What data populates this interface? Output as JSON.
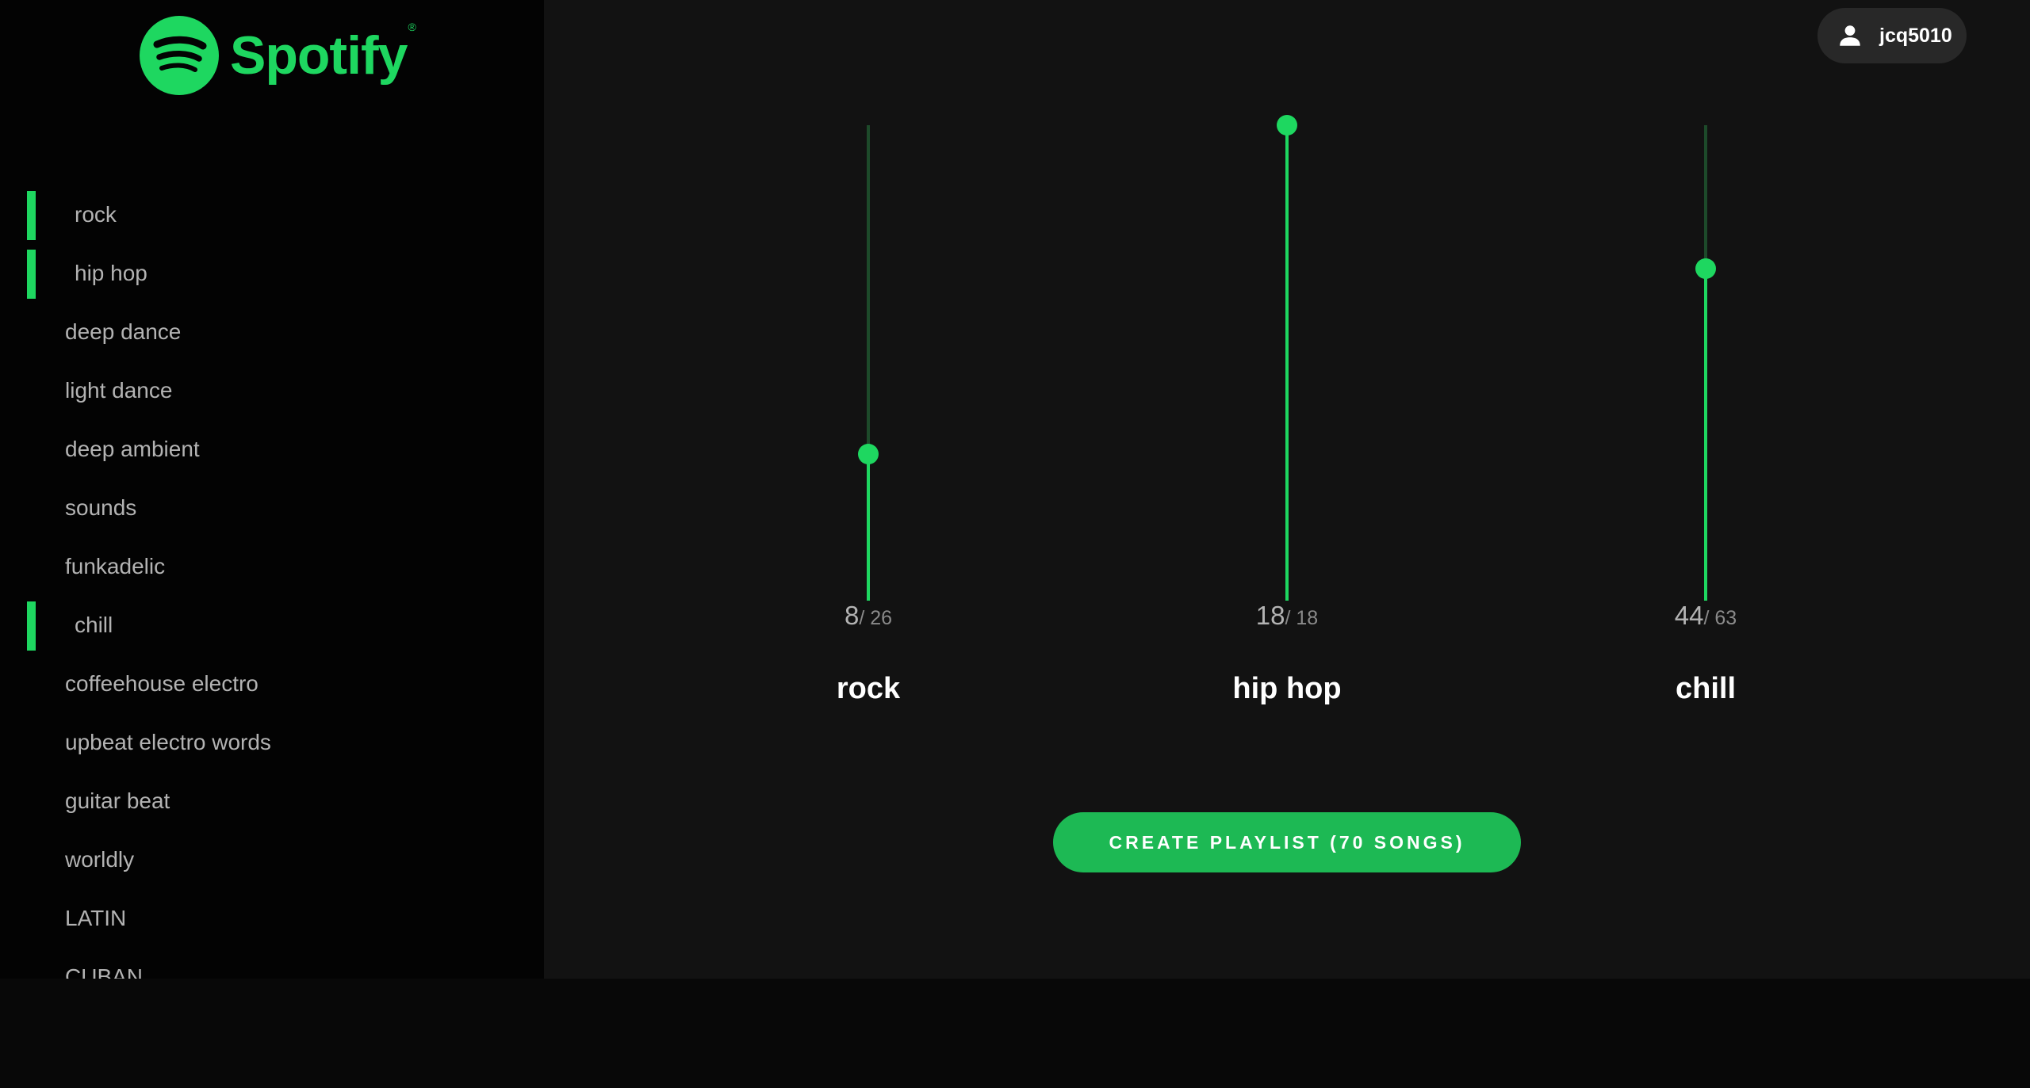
{
  "brand": {
    "name": "Spotify",
    "registered_mark": "®",
    "color": "#1ed760",
    "icon": "spotify-logo-icon"
  },
  "user": {
    "name": "jcq5010",
    "icon": "user-icon"
  },
  "sidebar": {
    "items": [
      {
        "label": "rock",
        "selected": true
      },
      {
        "label": "hip hop",
        "selected": true
      },
      {
        "label": "deep dance",
        "selected": false
      },
      {
        "label": "light dance",
        "selected": false
      },
      {
        "label": "deep ambient",
        "selected": false
      },
      {
        "label": "sounds",
        "selected": false
      },
      {
        "label": "funkadelic",
        "selected": false
      },
      {
        "label": "chill",
        "selected": true
      },
      {
        "label": "coffeehouse electro",
        "selected": false
      },
      {
        "label": "upbeat electro words",
        "selected": false
      },
      {
        "label": "guitar beat",
        "selected": false
      },
      {
        "label": "worldly",
        "selected": false
      },
      {
        "label": "LATIN",
        "selected": false
      },
      {
        "label": "CUBAN",
        "selected": false
      }
    ]
  },
  "sliders": [
    {
      "name": "rock",
      "value": 8,
      "max": 26,
      "max_label": "/ 26"
    },
    {
      "name": "hip hop",
      "value": 18,
      "max": 18,
      "max_label": "/ 18"
    },
    {
      "name": "chill",
      "value": 44,
      "max": 63,
      "max_label": "/ 63"
    }
  ],
  "create_button": {
    "label": "CREATE PLAYLIST (70 SONGS)"
  },
  "colors": {
    "accent": "#1ed760",
    "button": "#1db954",
    "track": "#1d4a2a",
    "main_bg": "#121212",
    "sidebar_bg": "#030303"
  }
}
